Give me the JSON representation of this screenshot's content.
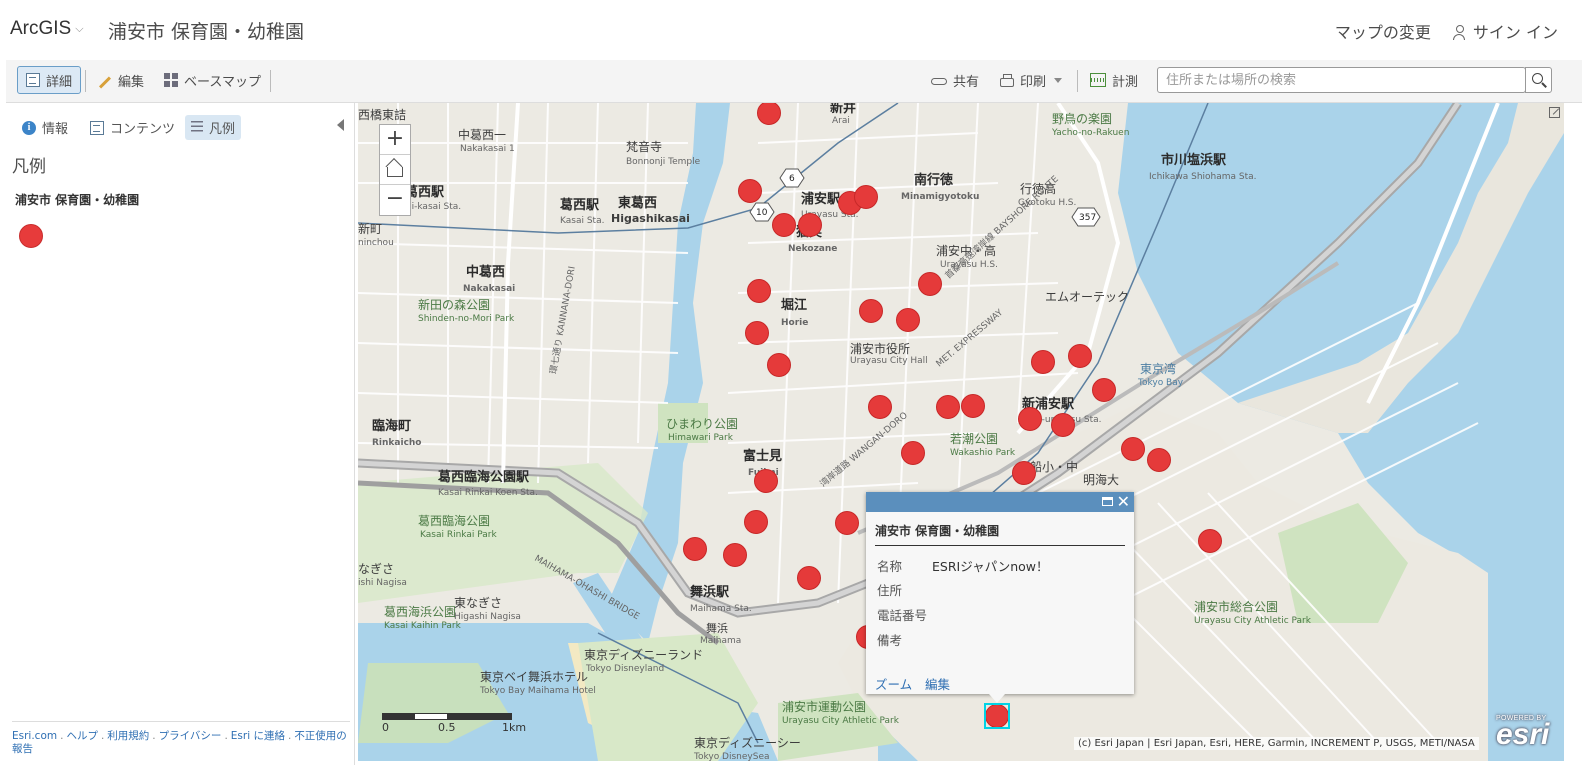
{
  "header": {
    "app_name": "ArcGIS",
    "app_chevron": "⌵",
    "map_title": "浦安市 保育園・幼稚園",
    "change_map": "マップの変更",
    "sign_in": "サイン イン"
  },
  "toolbar": {
    "details": "詳細",
    "edit": "編集",
    "basemap": "ベースマップ",
    "share": "共有",
    "print": "印刷",
    "measure": "計測",
    "search_placeholder": "住所または場所の検索"
  },
  "panel": {
    "tabs": {
      "info": "情報",
      "contents": "コンテンツ",
      "legend": "凡例"
    },
    "legend_title": "凡例",
    "layer_name": "浦安市 保育園・幼稚園",
    "symbol_color": "#e73b3b",
    "footer": {
      "esri": "Esri.com",
      "help": "ヘルプ",
      "terms": "利用規約",
      "privacy": "プライバシー",
      "contact": "Esri に連絡",
      "report": "不正使用の報告",
      "sep": "."
    }
  },
  "map": {
    "zoom_in": "+",
    "zoom_out": "−",
    "scale": {
      "t0": "0",
      "t1": "0.5",
      "t2": "1km"
    },
    "attribution": "(c) Esri Japan | Esri Japan, Esri, HERE, Garmin, INCREMENT P, USGS, METI/NASA",
    "esri_powered": "POWERED BY",
    "esri_name": "esri",
    "marker_color": "#e53a3a",
    "highway_shields": [
      "6",
      "10",
      "357"
    ],
    "labels": {
      "nishikasaibashi": "西橋東詰",
      "arai_jp": "新井",
      "arai_en": "Arai",
      "nakakasai1": "中葛西一",
      "nakakasai1_en": "Nakakasai 1",
      "bonnoji": "梵音寺",
      "bonnoji_en": "Bonnonji Temple",
      "nishikasai_st": "西葛西駅",
      "nishikasai_st_en": "Nishi-kasai Sta.",
      "kasai_st": "葛西駅",
      "kasai_st_en": "Kasai Sta.",
      "higashikasai": "東葛西",
      "higashikasai_en": "Higashikasai",
      "urayasu_st": "浦安駅",
      "urayasu_st_en": "Urayasu Sta.",
      "nekozane": "猫実",
      "nekozane_en": "Nekozane",
      "minamigyotoku": "南行徳",
      "minamigyotoku_en": "Minamigyotoku",
      "gyotoku_hs": "行徳高",
      "gyotoku_hs_en": "Gyotoku H.S.",
      "nomuragarden": "野鳥の楽園",
      "nomuragarden_en": "Yacho-no-Rakuen",
      "ichikawa_st": "市川塩浜駅",
      "ichikawa_st_en": "Ichikawa Shiohama Sta.",
      "nakakasai": "中葛西",
      "nakakasai_en": "Nakakasai",
      "shinden": "新田の森公園",
      "shinden_en": "Shinden-no-Mori Park",
      "horie": "堀江",
      "horie_en": "Horie",
      "urayasu_hs": "浦安中・高",
      "urayasu_hs_en": "Urayasu H.S.",
      "mori": "エムオーテック",
      "cityhall": "浦安市役所",
      "cityhall_en": "Urayasu City Hall",
      "tokyobay": "東京湾",
      "tokyobay_en": "Tokyo Bay",
      "rinkaicho": "臨海町",
      "rinkaicho_en": "Rinkaicho",
      "shinurayasu": "新浦安駅",
      "shinurayasu_en": "Shin-urayasu Sta.",
      "wakashio": "若潮公園",
      "wakashio_en": "Wakashio Park",
      "himawari": "ひまわり公園",
      "himawari_en": "Himawari Park",
      "fujimi": "富士見",
      "fujimi_en": "Fujimi",
      "rinkaipark_st": "葛西臨海公園駅",
      "rinkaipark_st_en": "Kasai Rinkai Koen Sta.",
      "rinkaipark": "葛西臨海公園",
      "rinkaipark_en": "Kasai Rinkai Park",
      "nagisa": "なぎさ",
      "nagisa_en": "ishi Nagisa",
      "kasaikaihin": "葛西海浜公園",
      "kasaikaihin_en": "Kasai Kaihin Park",
      "higashinagisa": "東なぎさ",
      "higashinagisa_en": "Higashi Nagisa",
      "maihama_st": "舞浜駅",
      "maihama_st_en": "Maihama Sta.",
      "maihama": "舞浜",
      "maihama_en": "Maihama",
      "disneyland": "東京ディズニーランド",
      "disneyland_en": "Tokyo Disneyland",
      "bayhotel": "東京ベイ舞浜ホテル",
      "bayhotel_en": "Tokyo Bay Maihama Hotel",
      "athletic": "浦安市運動公園",
      "athletic_en": "Urayasu City Athletic Park",
      "athletic2": "浦安市総合公園",
      "athletic2_en": "Urayasu City Athletic Park",
      "disneysea": "東京ディズニーシー",
      "disneysea_en": "Tokyo DisneySea",
      "akemi": "明海大",
      "irifune": "入船小・中",
      "bayshore": "首都高速湾岸線 BAYSHORE ROUTE",
      "kannana": "環七通り KANNANA-DORI",
      "wangan": "湾岸道路 WANGAN-DORO",
      "maihama_bridge": "MAIHAMA-OHASHI BRIDGE",
      "met": "MET. EXPRESSWAY",
      "nishimachi": "新町",
      "nishimachi_en": "ninchou"
    }
  },
  "popup": {
    "title": "浦安市 保育園・幼稚園",
    "fields": [
      {
        "label": "名称",
        "value": "ESRIジャパンnow！"
      },
      {
        "label": "住所",
        "value": ""
      },
      {
        "label": "電話番号",
        "value": ""
      },
      {
        "label": "備考",
        "value": ""
      }
    ],
    "zoom": "ズーム",
    "edit": "編集",
    "close": "✕"
  }
}
